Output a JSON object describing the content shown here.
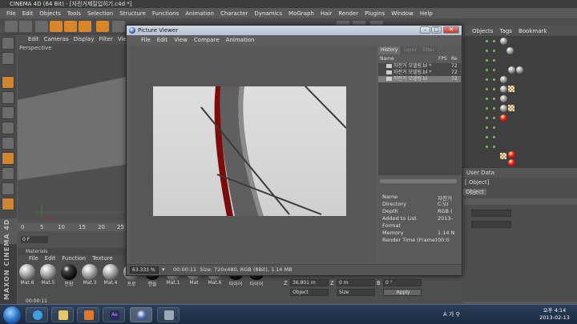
{
  "app": {
    "title": "CINEMA 4D (64 Bit) - [자전거제질입히기.c4d *]"
  },
  "main_menu": [
    "File",
    "Edit",
    "Objects",
    "Tools",
    "Selection",
    "Structure",
    "Functions",
    "Animation",
    "Character",
    "Dynamics",
    "MoGraph",
    "Hair",
    "Render",
    "Plugins",
    "Window",
    "Help"
  ],
  "viewport": {
    "menu": [
      "Edit",
      "Cameras",
      "Display",
      "Filter",
      "View"
    ],
    "label": "Perspective"
  },
  "timeline": {
    "ticks": [
      "0",
      "5",
      "10",
      "15",
      "20",
      "25"
    ],
    "current_frame": "0 F",
    "time": "00:00:11"
  },
  "materials": {
    "header": "Materials",
    "menu": [
      "File",
      "Edit",
      "Function",
      "Texture"
    ],
    "items": [
      "Mat.6",
      "Mat.5",
      "안장",
      "Mat.3",
      "Mat.4",
      "프로",
      "핸들",
      "Mat.1",
      "Mat",
      "Mat.6",
      "타이어",
      "타이어"
    ]
  },
  "brand": "MAXON CINEMA 4D",
  "object_manager": {
    "menu": [
      "Objects",
      "Tags",
      "Bookmark"
    ]
  },
  "attributes": {
    "header": "User Data",
    "line1": "[ Object]",
    "tab": "Object"
  },
  "coords": {
    "z_label": "Z",
    "z_pos": "36.801 m",
    "z_size": "0 m",
    "z_rot": "0 °",
    "mode": "Object",
    "size_mode": "Size",
    "apply": "Apply"
  },
  "picture_viewer": {
    "title": "Picture Viewer",
    "menu": [
      "File",
      "Edit",
      "View",
      "Compare",
      "Animation"
    ],
    "tabs": [
      "History",
      "Layer",
      "Filter"
    ],
    "history_columns": {
      "name": "Name",
      "fps": "FPS",
      "re": "Re"
    },
    "history": [
      {
        "name": "자전거 모델링.bl *",
        "fps": "72"
      },
      {
        "name": "자전거 모델링.bl *",
        "fps": "72"
      },
      {
        "name": "자전거 모델링.bl",
        "fps": "72"
      }
    ],
    "info": [
      {
        "label": "Name",
        "value": "자전거"
      },
      {
        "label": "Directory",
        "value": "C:\\U"
      },
      {
        "label": "Depth",
        "value": "RGB ("
      },
      {
        "label": "Added to List",
        "value": "2013-"
      },
      {
        "label": "Format",
        "value": ""
      },
      {
        "label": "Memory",
        "value": "1.14 N"
      },
      {
        "label": "Render Time (Frame)",
        "value": "00:0"
      }
    ],
    "zoom": "63.333 %",
    "status_time": "00:00:11",
    "status_text": "Size: 720x480, RGB (8Bit), 1.14 MB"
  },
  "taskbar": {
    "apps": [
      "ie",
      "explorer",
      "media",
      "after-effects",
      "cinema4d",
      "other"
    ],
    "tray": "A 가 ⚲",
    "time": "오후 4:14",
    "date": "2013-02-13"
  }
}
